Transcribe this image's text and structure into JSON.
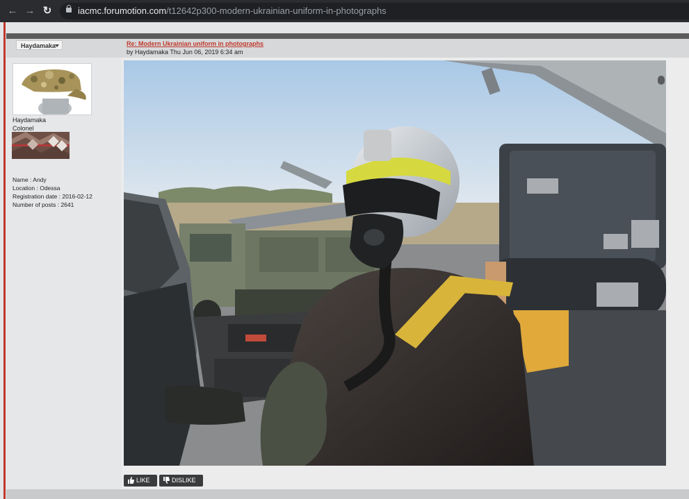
{
  "browser": {
    "url_host": "iacmc.forumotion.com",
    "url_path": "/t12642p300-modern-ukrainian-uniform-in-photographs",
    "icons": [
      "back-arrow-icon",
      "forward-arrow-icon",
      "reload-icon",
      "lock-icon"
    ]
  },
  "post": {
    "username_dropdown": "Haydamaka",
    "title": "Re: Modern Ukrainian uniform in photographs",
    "meta": "by Haydamaka Thu Jun 06, 2019 6:34 am"
  },
  "author": {
    "name": "Haydamaka",
    "rank": "Colonel",
    "profile": [
      "Name : Andy",
      "Location : Odessa",
      "Registration date : 2016-02-12",
      "Number of posts : 2641"
    ]
  },
  "actions": {
    "like": "LIKE",
    "dislike": "DISLIKE"
  },
  "colors": {
    "title_link": "#c0392b",
    "accent_line": "#c0392b",
    "chrome_bg": "#2b2c2f"
  }
}
